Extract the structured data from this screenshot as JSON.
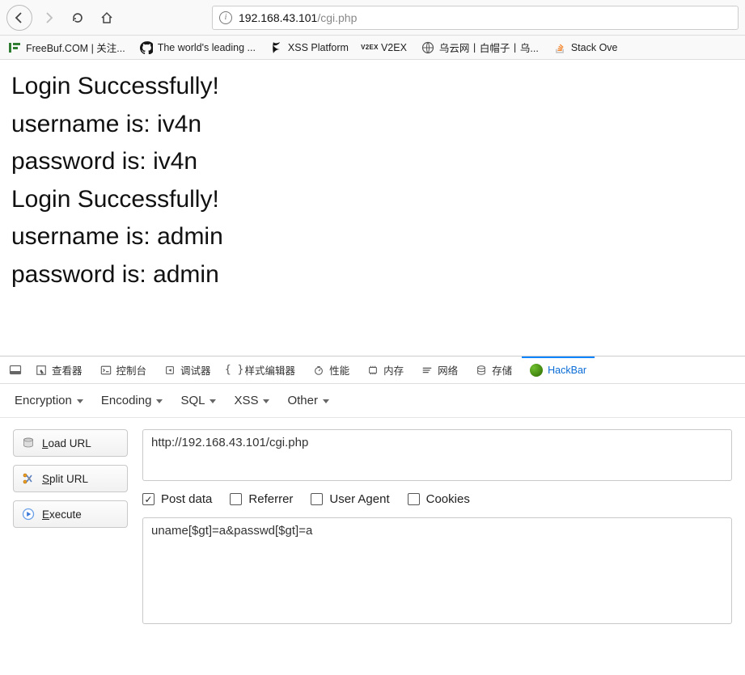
{
  "url": {
    "host": "192.168.43.101",
    "path": "/cgi.php"
  },
  "bookmarks": [
    {
      "name": "freebuf",
      "label": "FreeBuf.COM | 关注..."
    },
    {
      "name": "github",
      "label": "The world's leading ..."
    },
    {
      "name": "xss",
      "label": "XSS Platform"
    },
    {
      "name": "v2ex",
      "label": "V2EX"
    },
    {
      "name": "wooyun",
      "label": "乌云网丨白帽子丨乌..."
    },
    {
      "name": "stackoverflow",
      "label": "Stack Ove"
    }
  ],
  "page": {
    "lines": [
      "Login Successfully!",
      "username is: iv4n",
      "password is: iv4n",
      "Login Successfully!",
      "username is: admin",
      "password is: admin"
    ]
  },
  "devtools": {
    "tabs": {
      "inspector": "查看器",
      "console": "控制台",
      "debugger": "调试器",
      "style": "样式编辑器",
      "perf": "性能",
      "memory": "内存",
      "network": "网络",
      "storage": "存储",
      "hackbar": "HackBar"
    },
    "sub": {
      "encryption": "Encryption",
      "encoding": "Encoding",
      "sql": "SQL",
      "xss": "XSS",
      "other": "Other"
    },
    "sidebar": {
      "load": "oad URL",
      "split": "plit URL",
      "exec": "xecute"
    },
    "url_value": "http://192.168.43.101/cgi.php",
    "checks": {
      "post": "Post data",
      "referrer": "Referrer",
      "ua": "User Agent",
      "cookies": "Cookies"
    },
    "post_value": "uname[$gt]=a&passwd[$gt]=a"
  }
}
